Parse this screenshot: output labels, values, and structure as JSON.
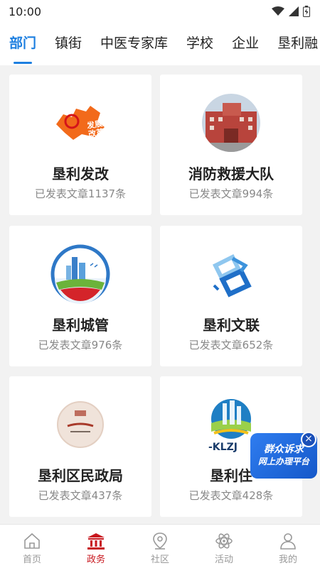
{
  "status_bar": {
    "time": "10:00"
  },
  "tabs": [
    {
      "label": "部门",
      "active": true
    },
    {
      "label": "镇街",
      "active": false
    },
    {
      "label": "中医专家库",
      "active": false
    },
    {
      "label": "学校",
      "active": false
    },
    {
      "label": "企业",
      "active": false
    },
    {
      "label": "垦利融",
      "active": false
    }
  ],
  "cards": [
    {
      "name": "垦利发改",
      "count": "已发表文章1137条",
      "logo": "red-map-emblem-icon",
      "logo_text": "发展改革"
    },
    {
      "name": "消防救援大队",
      "count": "已发表文章994条",
      "logo": "building-photo-icon"
    },
    {
      "name": "垦利城管",
      "count": "已发表文章976条",
      "logo": "city-emblem-icon"
    },
    {
      "name": "垦利文联",
      "count": "已发表文章652条",
      "logo": "blue-3d-shape-icon"
    },
    {
      "name": "垦利区民政局",
      "count": "已发表文章437条",
      "logo": "civil-affairs-seal-icon"
    },
    {
      "name": "垦利住",
      "count": "已发表文章428条",
      "logo": "klzj-emblem-icon",
      "logo_text": "-KLZJ"
    }
  ],
  "float_banner": {
    "line1": "群众诉求",
    "line2": "网上办理平台",
    "close": "×"
  },
  "bottom_nav": [
    {
      "label": "首页",
      "icon": "home-icon",
      "active": false
    },
    {
      "label": "政务",
      "icon": "government-icon",
      "active": true
    },
    {
      "label": "社区",
      "icon": "location-pin-icon",
      "active": false
    },
    {
      "label": "活动",
      "icon": "activity-icon",
      "active": false
    },
    {
      "label": "我的",
      "icon": "user-icon",
      "active": false
    }
  ],
  "colors": {
    "accent": "#1d7fe0",
    "nav_active": "#c8161d",
    "banner": "#2f7df0"
  }
}
